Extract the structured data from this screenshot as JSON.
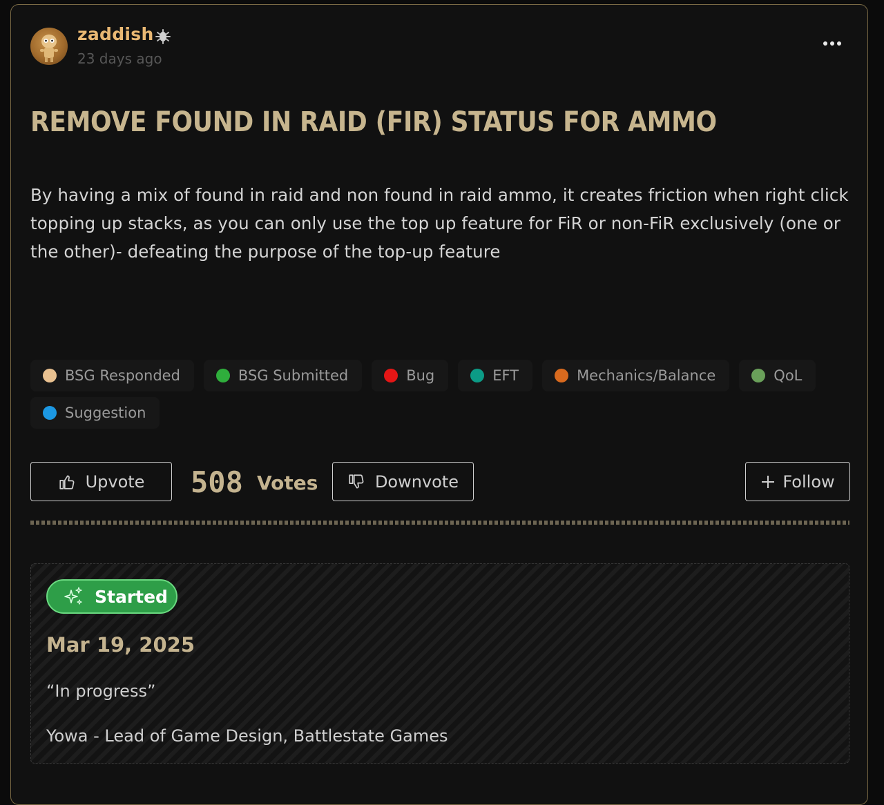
{
  "post": {
    "author": "zaddish",
    "time_ago": "23 days ago",
    "title": "REMOVE FOUND IN RAID (FIR) STATUS FOR AMMO",
    "body": "By having a mix of found in raid and non found in raid ammo, it creates friction when right click topping up stacks, as you can only use the top up feature for FiR or non-FiR exclusively (one or the other)- defeating the purpose of the top-up feature"
  },
  "tags": [
    {
      "label": "BSG Responded",
      "color": "#e9c190"
    },
    {
      "label": "BSG Submitted",
      "color": "#2fae3c"
    },
    {
      "label": "Bug",
      "color": "#e51616"
    },
    {
      "label": "EFT",
      "color": "#0c9b86"
    },
    {
      "label": "Mechanics/Balance",
      "color": "#d96a1e"
    },
    {
      "label": "QoL",
      "color": "#6aa05a"
    },
    {
      "label": "Suggestion",
      "color": "#1c98e3"
    }
  ],
  "actions": {
    "upvote_label": "Upvote",
    "votes_count": "508",
    "votes_label": "Votes",
    "downvote_label": "Downvote",
    "follow_label": "Follow"
  },
  "status": {
    "label": "Started",
    "date": "Mar 19, 2025",
    "quote": "“In progress”",
    "author": "Yowa - Lead of Game Design, Battlestate Games"
  },
  "icons": {
    "author_badge": "bug-icon",
    "more": "more-icon",
    "upvote": "thumbs-up-icon",
    "downvote": "thumbs-down-icon",
    "follow": "plus-icon",
    "status": "sparkles-icon"
  },
  "colors": {
    "accent": "#e9b873",
    "title": "#c7b58e",
    "status_green": "#2e9e48"
  }
}
